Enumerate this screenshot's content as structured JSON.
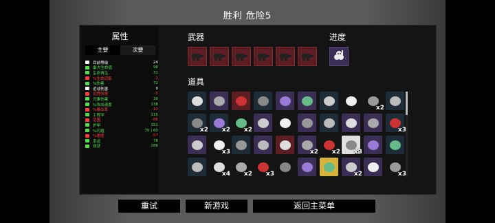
{
  "header": {
    "title": "胜利  危险5"
  },
  "stats": {
    "title": "属性",
    "tabs": [
      {
        "label": "主要"
      },
      {
        "label": "次要"
      }
    ],
    "rows": [
      {
        "name": "目前等级",
        "value": "24",
        "color": "#ffffff",
        "icon": "level-icon"
      },
      {
        "name": "最大生命值",
        "value": "96",
        "color": "#53e04e",
        "icon": "heart-icon"
      },
      {
        "name": "生命再生",
        "value": "31",
        "color": "#53e04e",
        "icon": "regen-icon"
      },
      {
        "name": "%生命窃取",
        "value": "-1",
        "color": "#ff3c3c",
        "icon": "lifesteal-icon"
      },
      {
        "name": "%伤害",
        "value": "72",
        "color": "#53e04e",
        "icon": "damage-icon"
      },
      {
        "name": "近战伤害",
        "value": "0",
        "color": "#ffffff",
        "icon": "melee-icon"
      },
      {
        "name": "远程伤害",
        "value": "-5",
        "color": "#ff3c3c",
        "icon": "ranged-icon"
      },
      {
        "name": "元素伤害",
        "value": "30",
        "color": "#53e04e",
        "icon": "elemental-icon"
      },
      {
        "name": "%攻击速度",
        "value": "138",
        "color": "#53e04e",
        "icon": "attack-speed-icon"
      },
      {
        "name": "%暴击率",
        "value": "-10",
        "color": "#ff3c3c",
        "icon": "crit-icon"
      },
      {
        "name": "工程学",
        "value": "116",
        "color": "#53e04e",
        "icon": "engineering-icon"
      },
      {
        "name": "范围",
        "value": "-86",
        "color": "#ff3c3c",
        "icon": "range-icon"
      },
      {
        "name": "护甲",
        "value": "151",
        "color": "#53e04e",
        "icon": "armor-icon"
      },
      {
        "name": "%闪避",
        "value": "70 | 60",
        "color": "#53e04e",
        "icon": "dodge-icon"
      },
      {
        "name": "%速度",
        "value": "-57",
        "color": "#ff3c3c",
        "icon": "speed-icon"
      },
      {
        "name": "幸运",
        "value": "78",
        "color": "#53e04e",
        "icon": "luck-icon"
      },
      {
        "name": "收获",
        "value": "286",
        "color": "#53e04e",
        "icon": "harvest-icon"
      }
    ]
  },
  "weapons": {
    "label": "武器",
    "slots": [
      {
        "icon": "turret-weapon-icon"
      },
      {
        "icon": "turret-weapon-icon"
      },
      {
        "icon": "turret-weapon-icon"
      },
      {
        "icon": "turret-weapon-icon"
      },
      {
        "icon": "turret-weapon-icon"
      },
      {
        "icon": "turret-weapon-icon"
      }
    ],
    "color": "#5c1e23"
  },
  "progress": {
    "label": "进度",
    "icon": "character-progress-icon",
    "color": "#3a2e55"
  },
  "items": {
    "label": "道具",
    "rows": [
      [
        {
          "icon": "robot-face-icon",
          "bg": "#1e2c38",
          "count": ""
        },
        {
          "icon": "gauntlet-icon",
          "bg": "#3a2e55",
          "count": ""
        },
        {
          "icon": "wrench-icon",
          "bg": "#5c1e23",
          "count": ""
        },
        {
          "icon": "hooded-eye-icon",
          "bg": "#1e2c38",
          "count": ""
        },
        {
          "icon": "tentacle-icon",
          "bg": "#3a2e55",
          "count": ""
        },
        {
          "icon": "circuit-icon",
          "bg": "#3a2e55",
          "count": ""
        },
        {
          "icon": "bandage-icon",
          "bg": "#1e2c38",
          "count": ""
        },
        {
          "icon": "ghost-icon",
          "bg": "#141414",
          "count": ""
        },
        {
          "icon": "drone-icon",
          "bg": "#141414",
          "count": "x2"
        },
        {
          "icon": "skull-mask-icon",
          "bg": "#1e2c38",
          "count": ""
        }
      ],
      [
        {
          "icon": "bowl-icon",
          "bg": "#1e2c38",
          "count": "x2"
        },
        {
          "icon": "crossed-tools-icon",
          "bg": "#1e2c38",
          "count": "x2"
        },
        {
          "icon": "scarf-icon",
          "bg": "#141414",
          "count": "x2"
        },
        {
          "icon": "top-hat-icon",
          "bg": "#3a2e55",
          "count": ""
        },
        {
          "icon": "snail-icon",
          "bg": "#141414",
          "count": ""
        },
        {
          "icon": "mage-icon",
          "bg": "#3a2e55",
          "count": ""
        },
        {
          "icon": "cap-icon",
          "bg": "#1e2c38",
          "count": ""
        },
        {
          "icon": "plank-icon",
          "bg": "#3a2e55",
          "count": ""
        },
        {
          "icon": "frog-icon",
          "bg": "#3a2e55",
          "count": ""
        },
        {
          "icon": "bug-icon",
          "bg": "#1e2c38",
          "count": "x3"
        }
      ],
      [
        {
          "icon": "cannon-icon",
          "bg": "#3a2e55",
          "count": ""
        },
        {
          "icon": "spider-icon",
          "bg": "#141414",
          "count": "x3"
        },
        {
          "icon": "chameleon-icon",
          "bg": "#1e2c38",
          "count": ""
        },
        {
          "icon": "claws-icon",
          "bg": "#3a2e55",
          "count": ""
        },
        {
          "icon": "tomato-icon",
          "bg": "#5c1e23",
          "count": ""
        },
        {
          "icon": "candle-icon",
          "bg": "#3a2e55",
          "count": "x2"
        },
        {
          "icon": "bomb-icon",
          "bg": "#141414",
          "count": "x2"
        },
        {
          "icon": "crystal-icon",
          "bg": "#e0e0e0",
          "count": "x3"
        },
        {
          "icon": "claw-slash-icon",
          "bg": "#3a2e55",
          "count": ""
        },
        {
          "icon": "bottle-icon",
          "bg": "#1e2c38",
          "count": ""
        }
      ],
      [
        {
          "icon": "flag-icon",
          "bg": "#1e2c38",
          "count": ""
        },
        {
          "icon": "dagger-icon",
          "bg": "#141414",
          "count": "x4"
        },
        {
          "icon": "potion-icon",
          "bg": "#141414",
          "count": "x2"
        },
        {
          "icon": "fish-icon",
          "bg": "#141414",
          "count": "x3"
        },
        {
          "icon": "net-icon",
          "bg": "#141414",
          "count": ""
        },
        {
          "icon": "shell-icon",
          "bg": "#3a2e55",
          "count": ""
        },
        {
          "icon": "treasure-icon",
          "bg": "#d9b23a",
          "count": ""
        },
        {
          "icon": "robot-head-icon",
          "bg": "#3a2e55",
          "count": "x2"
        },
        {
          "icon": "skull-icon",
          "bg": "#3a2e55",
          "count": ""
        },
        {
          "icon": "mushroom-icon",
          "bg": "#141414",
          "count": "x3"
        }
      ]
    ]
  },
  "buttons": {
    "retry": "重试",
    "new_game": "新游戏",
    "main_menu": "返回主菜单"
  }
}
